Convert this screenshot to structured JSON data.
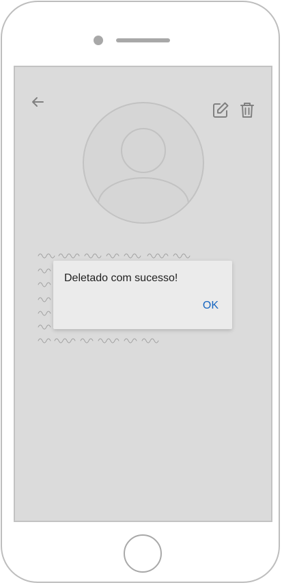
{
  "screen": {
    "background": "#dbdbdb",
    "toolbar": {
      "back_icon": "arrow-left-icon",
      "edit_icon": "edit-icon",
      "delete_icon": "trash-icon"
    },
    "avatar_icon": "user-avatar-placeholder"
  },
  "dialog": {
    "message": "Deletado com sucesso!",
    "ok_label": "OK",
    "accent_color": "#1565c0"
  }
}
